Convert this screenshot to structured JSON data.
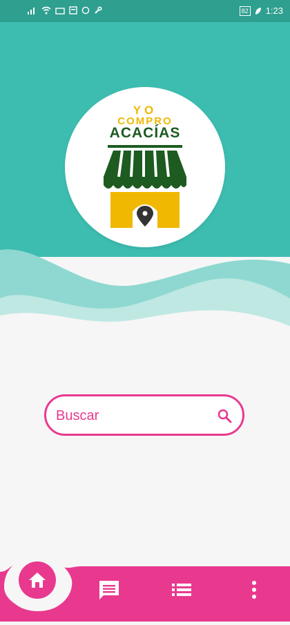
{
  "status_bar": {
    "time": "1:23",
    "battery": "82"
  },
  "logo": {
    "line1": "YO",
    "line2": "COMPRO",
    "line3": "ACACÍAS"
  },
  "search": {
    "placeholder": "Buscar"
  },
  "colors": {
    "teal": "#3dbdb0",
    "teal_light": "#8fd8d1",
    "pink": "#e8398f",
    "green": "#1d5b21",
    "yellow": "#f0b800"
  },
  "icons": {
    "search": "search-icon",
    "home": "home-icon",
    "chat": "chat-icon",
    "list": "list-icon",
    "more": "more-vert-icon"
  }
}
